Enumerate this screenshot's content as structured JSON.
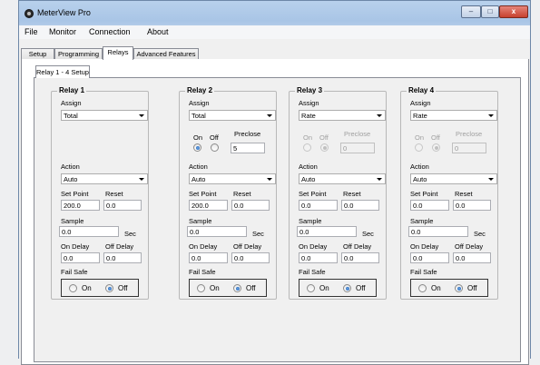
{
  "app": {
    "title": "MeterView Pro"
  },
  "window_buttons": {
    "minimize": "–",
    "maximize": "□",
    "close": "x"
  },
  "menu": [
    "File",
    "Monitor",
    "Connection",
    "About"
  ],
  "tabs": [
    "Setup",
    "Programming",
    "Relays",
    "Advanced Features"
  ],
  "inner_tab": "Relay 1 - 4 Setup",
  "labels": {
    "assign": "Assign",
    "on": "On",
    "off": "Off",
    "preclose": "Preclose",
    "action": "Action",
    "set_point": "Set Point",
    "reset": "Reset",
    "sample": "Sample",
    "sec": "Sec",
    "on_delay": "On Delay",
    "off_delay": "Off Delay",
    "fail_safe": "Fail Safe"
  },
  "relays": [
    {
      "title": "Relay 1",
      "assign": "Total",
      "preclose_visible": false,
      "action": "Auto",
      "set_point": "200.0",
      "reset": "0.0",
      "sample": "0.0",
      "on_delay": "0.0",
      "off_delay": "0.0"
    },
    {
      "title": "Relay 2",
      "assign": "Total",
      "preclose_visible": true,
      "preclose_enabled": true,
      "preclose": "5",
      "action": "Auto",
      "set_point": "200.0",
      "reset": "0.0",
      "sample": "0.0",
      "on_delay": "0.0",
      "off_delay": "0.0"
    },
    {
      "title": "Relay 3",
      "assign": "Rate",
      "preclose_visible": true,
      "preclose_enabled": false,
      "preclose": "0",
      "action": "Auto",
      "set_point": "0.0",
      "reset": "0.0",
      "sample": "0.0",
      "on_delay": "0.0",
      "off_delay": "0.0"
    },
    {
      "title": "Relay 4",
      "assign": "Rate",
      "preclose_visible": true,
      "preclose_enabled": false,
      "preclose": "0",
      "action": "Auto",
      "set_point": "0.0",
      "reset": "0.0",
      "sample": "0.0",
      "on_delay": "0.0",
      "off_delay": "0.0"
    }
  ]
}
